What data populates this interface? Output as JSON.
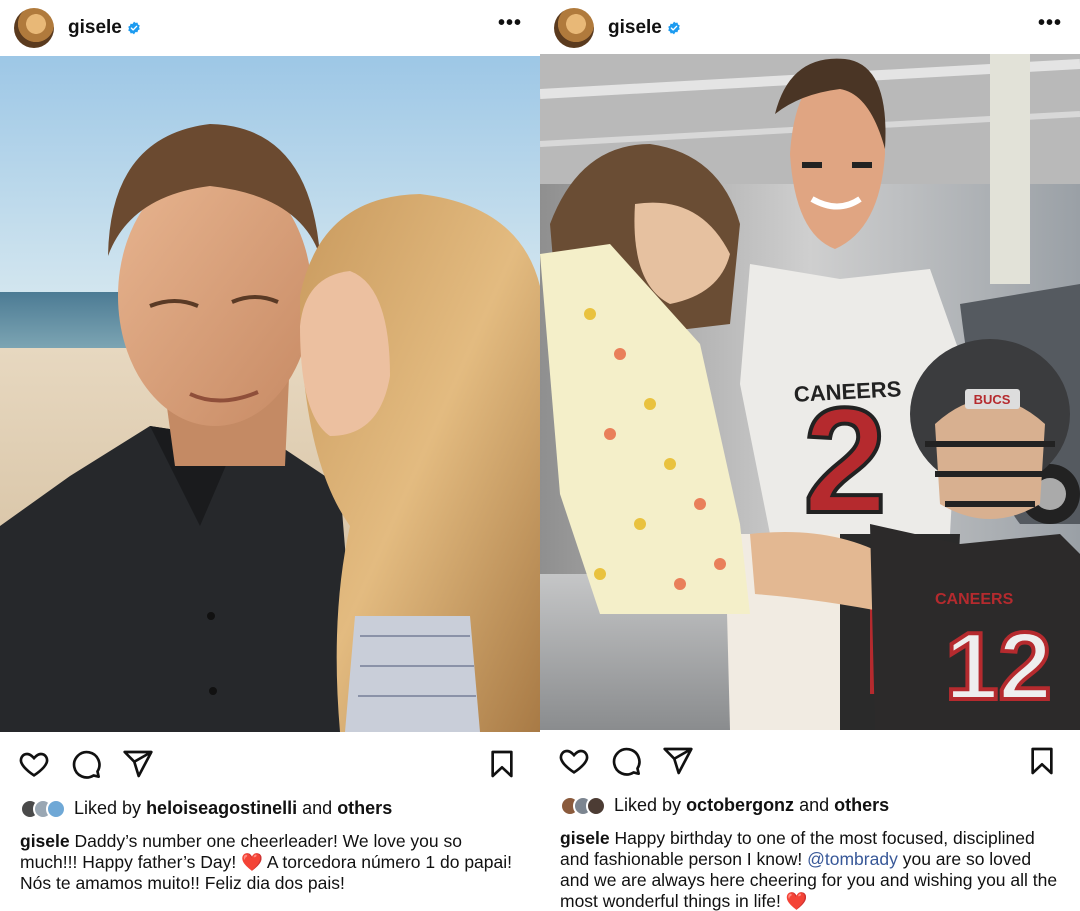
{
  "posts": [
    {
      "username": "gisele",
      "likes": {
        "prefix": "Liked by",
        "user": "heloiseagostinelli",
        "joiner": "and",
        "others": "others"
      },
      "caption": {
        "author": "gisele",
        "text_before": "Daddy’s number one cheerleader! We love you so much!!! Happy father’s Day!",
        "emoji": "❤️",
        "text_after": "A torcedora número 1 do papai! Nós te amamos muito!! Feliz dia dos pais!"
      }
    },
    {
      "username": "gisele",
      "likes": {
        "prefix": "Liked by",
        "user": "octobergonz",
        "joiner": "and",
        "others": "others"
      },
      "caption": {
        "author": "gisele",
        "text_before": "Happy birthday to one of the most focused, disciplined and fashionable person I know!",
        "mention": "@tombrady",
        "text_after": "you are so loved and we are always here cheering for you and wishing you all the most wonderful things in life!",
        "emoji": "❤️"
      }
    }
  ],
  "jersey": {
    "number": "2",
    "number_kid": "12",
    "team_text": "CANEERS",
    "team_text_kid": "CANEERS",
    "helmet_text": "BUCS"
  },
  "icons": [
    "verified-badge-icon",
    "more-options-icon",
    "heart-icon",
    "comment-icon",
    "share-icon",
    "bookmark-icon"
  ],
  "colors": {
    "verified": "#1d9bf0",
    "text": "#111111",
    "mention": "#385898",
    "heart": "#e0262f"
  }
}
